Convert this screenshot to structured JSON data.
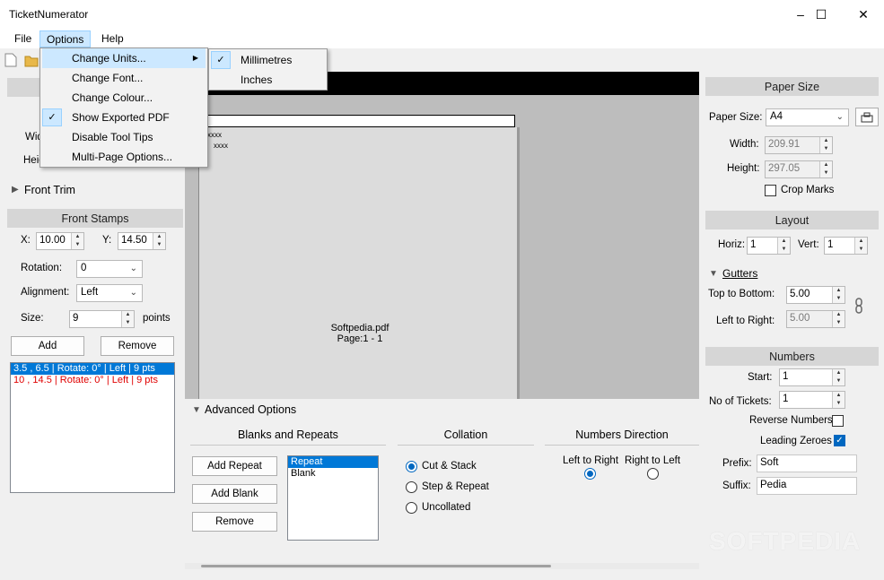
{
  "window": {
    "title": "TicketNumerator",
    "minimize": "–",
    "maximize": "☐",
    "close": "✕"
  },
  "menubar": {
    "file": "File",
    "options": "Options",
    "help": "Help"
  },
  "options_menu": {
    "items": [
      "Change Units...",
      "Change Font...",
      "Change Colour...",
      "Show Exported PDF",
      "Disable Tool Tips",
      "Multi-Page Options..."
    ],
    "checked_item": "Show Exported PDF",
    "submenu_arrow": "▶"
  },
  "units_submenu": {
    "items": [
      "Millimetres",
      "Inches"
    ],
    "checked_item": "Millimetres"
  },
  "left_panel": {
    "width_label_partial": "Wid",
    "height_label_partial": "Heig",
    "front_trim": "Front Trim",
    "front_stamps": "Front Stamps",
    "x_label": "X:",
    "x_value": "10.00",
    "y_label": "Y:",
    "y_value": "14.50",
    "rotation_label": "Rotation:",
    "rotation_value": "0",
    "alignment_label": "Alignment:",
    "alignment_value": "Left",
    "size_label": "Size:",
    "size_value": "9",
    "size_unit": "points",
    "add_button": "Add",
    "remove_button": "Remove",
    "stamps": [
      {
        "text": "3.5 , 6.5 | Rotate: 0° | Left | 9 pts",
        "selected": true
      },
      {
        "text": "10 , 14.5 | Rotate: 0° | Left | 9 pts",
        "selected": false,
        "color": "#e00000"
      }
    ]
  },
  "preview": {
    "stamp_marks": [
      "xxxx",
      "xxxx"
    ],
    "file_name": "Softpedia.pdf",
    "page_info": "Page:1 - 1"
  },
  "advanced": {
    "header": "Advanced Options",
    "blanks_header": "Blanks and Repeats",
    "add_repeat": "Add Repeat",
    "add_blank": "Add Blank",
    "remove": "Remove",
    "blanks_list": [
      {
        "text": "Repeat",
        "selected": true
      },
      {
        "text": "Blank",
        "selected": false
      }
    ],
    "collation_header": "Collation",
    "collation_options": [
      "Cut & Stack",
      "Step & Repeat",
      "Uncollated"
    ],
    "collation_selected": "Cut & Stack",
    "direction_header": "Numbers Direction",
    "direction_options": [
      "Left to Right",
      "Right to Left"
    ],
    "direction_selected": "Left to Right"
  },
  "right_panel": {
    "paper_size_header": "Paper Size",
    "paper_size_label": "Paper Size:",
    "paper_size_value": "A4",
    "width_label": "Width:",
    "width_value": "209.91",
    "height_label": "Height:",
    "height_value": "297.05",
    "crop_marks": "Crop Marks",
    "layout_header": "Layout",
    "horiz_label": "Horiz:",
    "horiz_value": "1",
    "vert_label": "Vert:",
    "vert_value": "1",
    "gutters": "Gutters",
    "top_bottom_label": "Top to Bottom:",
    "top_bottom_value": "5.00",
    "left_right_label": "Left to Right:",
    "left_right_value": "5.00",
    "numbers_header": "Numbers",
    "start_label": "Start:",
    "start_value": "1",
    "tickets_label": "No of Tickets:",
    "tickets_value": "1",
    "reverse_label": "Reverse Numbers",
    "leading_label": "Leading Zeroes",
    "prefix_label": "Prefix:",
    "prefix_value": "Soft",
    "suffix_label": "Suffix:",
    "suffix_value": "Pedia"
  },
  "watermark": "SOFTPEDIA",
  "colors": {
    "accent": "#0078d7",
    "menu_highlight": "#cce8ff",
    "section_header": "#d6d6d6",
    "error_text": "#e00000"
  }
}
